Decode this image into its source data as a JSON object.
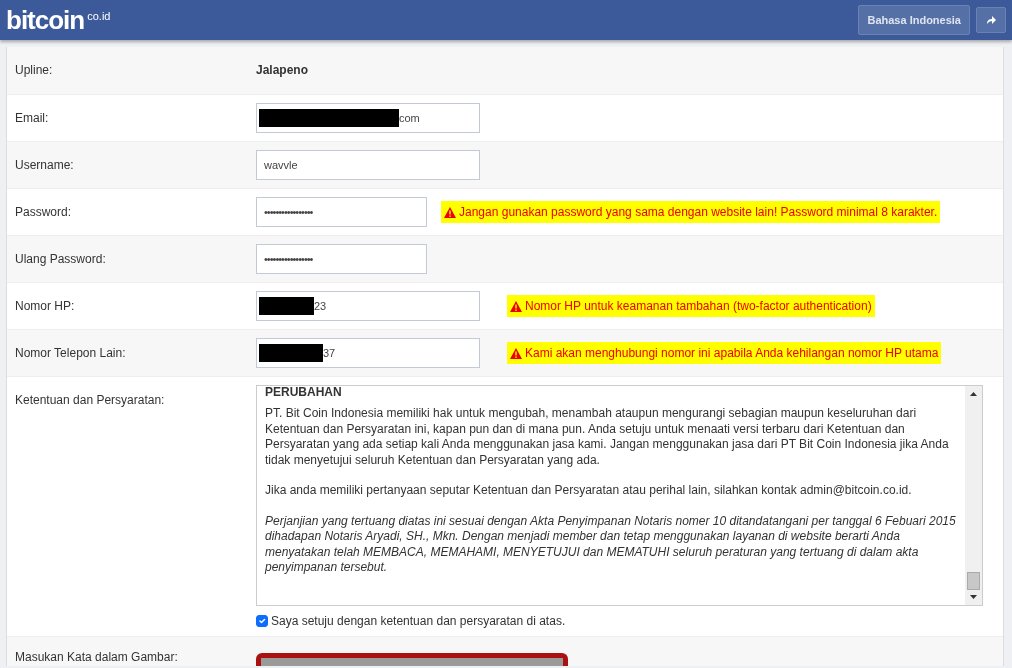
{
  "navbar": {
    "logo": {
      "name": "bitcoin",
      "suffix": "co.id"
    },
    "language_button": "Bahasa Indonesia"
  },
  "form": {
    "rows": [
      {
        "kind": "text",
        "label": "Upline:",
        "value": "Jalapeno"
      },
      {
        "kind": "input",
        "label": "Email:",
        "value": "com",
        "redacted": true,
        "wide": true
      },
      {
        "kind": "input",
        "label": "Username:",
        "value": "wavvle",
        "redacted": false,
        "wide": true
      },
      {
        "kind": "password",
        "label": "Password:",
        "value": "•••••••••••••••••",
        "wide": false,
        "warning": "Jangan gunakan password yang sama dengan website lain! Password minimal 8 karakter."
      },
      {
        "kind": "password",
        "label": "Ulang Password:",
        "value": "•••••••••••••••••",
        "wide": false
      },
      {
        "kind": "input",
        "label": "Nomor HP:",
        "value": "23",
        "redacted": true,
        "wide": true,
        "warning": "Nomor HP untuk keamanan tambahan (two-factor authentication)"
      },
      {
        "kind": "input",
        "label": "Nomor Telepon Lain:",
        "value": "37",
        "redacted": true,
        "wide": true,
        "warning": "Kami akan menghubungi nomor ini apabila Anda kehilangan nomor HP utama"
      },
      {
        "kind": "terms",
        "label": "Ketentuan dan Persyaratan:",
        "heading": "PERUBAHAN",
        "paragraphs": [
          {
            "italic": false,
            "text": "PT. Bit Coin Indonesia memiliki hak untuk mengubah, menambah ataupun mengurangi sebagian maupun keseluruhan dari Ketentuan dan Persyaratan ini, kapan pun dan di mana pun. Anda setuju untuk menaati versi terbaru dari Ketentuan dan Persyaratan yang ada setiap kali Anda menggunakan jasa kami. Jangan menggunakan jasa dari PT Bit Coin Indonesia jika Anda tidak menyetujui seluruh Ketentuan dan Persyaratan yang ada."
          },
          {
            "italic": false,
            "text": "Jika anda memiliki pertanyaan seputar Ketentuan dan Persyaratan atau perihal lain, silahkan kontak admin@bitcoin.co.id."
          },
          {
            "italic": true,
            "text": "Perjanjian yang tertuang diatas ini sesuai dengan Akta Penyimpanan Notaris nomer 10 ditandatangani per tanggal 6 Febuari 2015 dihadapan Notaris Aryadi, SH., Mkn. Dengan menjadi member dan tetap menggunakan layanan di website berarti Anda menyatakan telah MEMBACA, MEMAHAMI, MENYETUJUI dan MEMATUHI seluruh peraturan yang tertuang di dalam akta penyimpanan tersebut."
          }
        ],
        "agree": {
          "label": "Saya setuju dengan ketentuan dan persyaratan di atas.",
          "checked": true
        }
      },
      {
        "kind": "captcha",
        "label": "Masukan Kata dalam Gambar:"
      }
    ]
  }
}
